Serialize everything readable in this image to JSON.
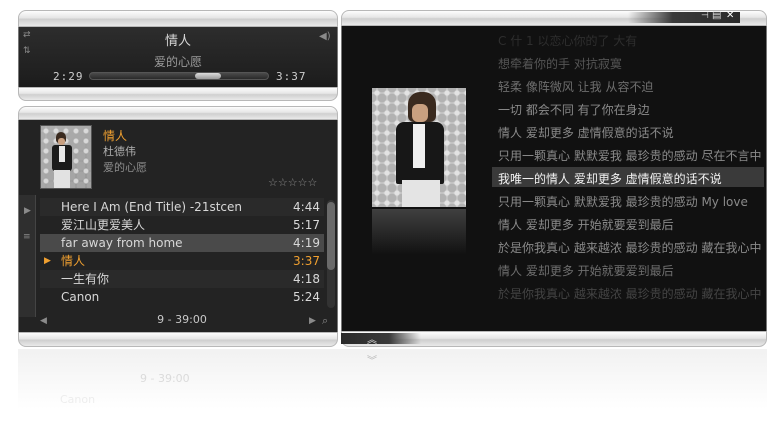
{
  "now_playing": {
    "title": "情人",
    "album": "爱的心愿",
    "elapsed": "2:29",
    "total": "3:37",
    "progress_fraction": 0.69
  },
  "track_info": {
    "title": "情人",
    "artist": "杜德伟",
    "album": "爱的心愿",
    "rating_stars": "☆☆☆☆☆"
  },
  "playlist": {
    "rows": [
      {
        "title": "Here I Am (End Title) -21stcen",
        "duration": "4:44"
      },
      {
        "title": "爱江山更爱美人",
        "duration": "5:17"
      },
      {
        "title": "far away from home",
        "duration": "4:19"
      },
      {
        "title": "情人",
        "duration": "3:37"
      },
      {
        "title": "一生有你",
        "duration": "4:18"
      },
      {
        "title": "Canon",
        "duration": "5:24"
      }
    ],
    "footer": "9 - 39:00",
    "play_indicator": "▶"
  },
  "lyrics": {
    "lines": [
      "想牵着你的手 对抗寂寞",
      "轻柔 像阵微风 让我 从容不迫",
      "一切 都会不同 有了你在身边",
      "情人 爱却更多 虚情假意的话不说",
      "只用一颗真心 默默爱我 最珍贵的感动 尽在不言中",
      "我唯一的情人 爱却更多 虚情假意的话不说",
      "只用一颗真心 默默爱我 最珍贵的感动 My love",
      "情人 爱却更多 开始就要爱到最后",
      "於是你我真心 越来越浓 最珍贵的感动 藏在我心中",
      "情人 爱却更多 开始就要爱到最后",
      "於是你我真心 越来越浓 最珍贵的感动 藏在我心中"
    ]
  },
  "reflection": {
    "footer": "9 - 39:00",
    "canon": "Canon"
  },
  "icons": {
    "pin": "📌",
    "restore": "▤",
    "close": "✕",
    "up": "︽",
    "down": "︾"
  },
  "colors": {
    "accent": "#f0a030",
    "panel": "#232323"
  }
}
